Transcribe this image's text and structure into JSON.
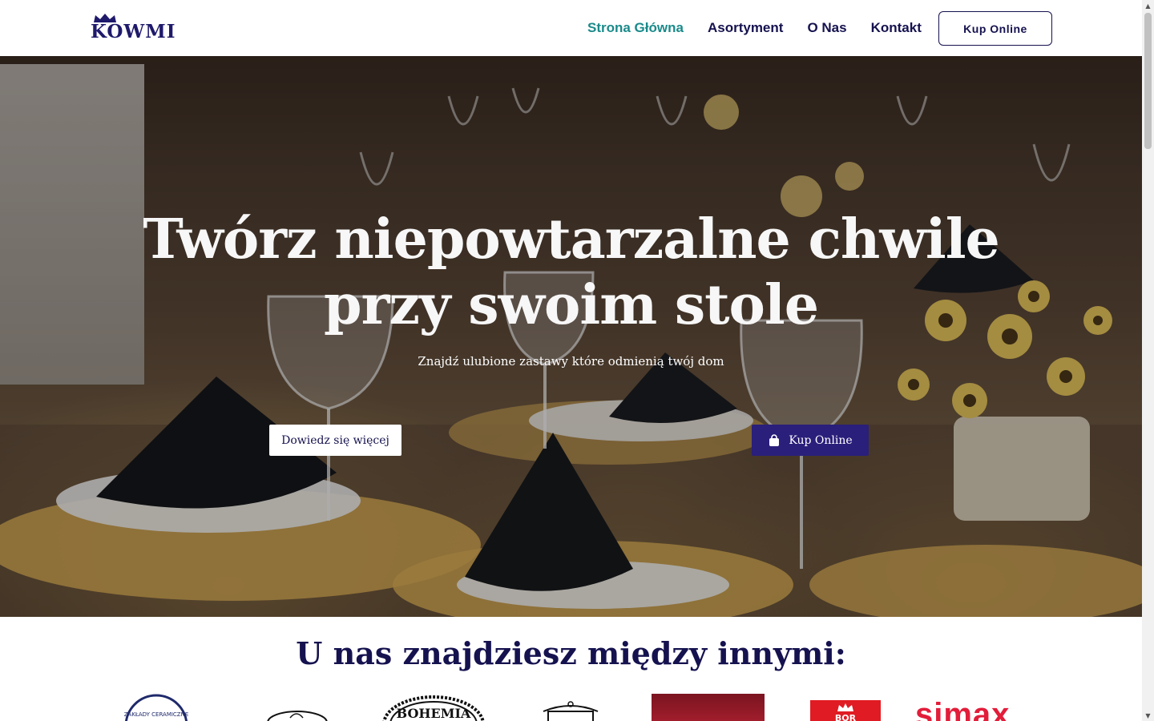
{
  "header": {
    "logo_text": "KOWMI",
    "nav": [
      {
        "label": "Strona Główna",
        "active": true
      },
      {
        "label": "Asortyment",
        "active": false
      },
      {
        "label": "O Nas",
        "active": false
      },
      {
        "label": "Kontakt",
        "active": false
      }
    ],
    "cta_label": "Kup Online"
  },
  "hero": {
    "title_line1": "Twórz niepowtarzalne chwile",
    "title_line2": "przy swoim stole",
    "subtitle": "Znajdź ulubione zastawy które odmienią twój dom",
    "more_button": "Dowiedz się więcej",
    "buy_button": "Kup Online",
    "buy_icon": "shopping-bag-icon"
  },
  "brands": {
    "title": "U nas znajdziesz między innymi:",
    "logos": [
      {
        "name": "zaklady-ceramiczne-logo",
        "text": "ZAKŁADY CERAMICZNE"
      },
      {
        "name": "porcelain-script-logo",
        "text": ""
      },
      {
        "name": "bohemia-logo",
        "text": "BOHEMIA"
      },
      {
        "name": "cookware-pot-logo",
        "text": ""
      },
      {
        "name": "red-panel-logo",
        "text": ""
      },
      {
        "name": "royal-crown-red-logo",
        "text": "BOR"
      },
      {
        "name": "simax-logo",
        "text": "simax"
      }
    ]
  },
  "colors": {
    "brand_navy": "#15124f",
    "active_teal": "#1a8a8a",
    "buy_button": "#2a1f7a"
  }
}
